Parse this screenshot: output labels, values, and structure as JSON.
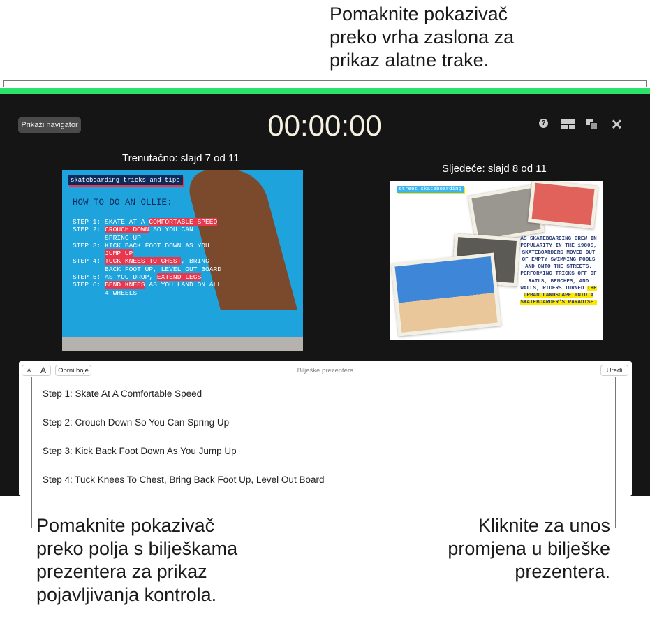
{
  "callouts": {
    "top": [
      "Pomaknite pokazivač",
      "preko vrha zaslona za",
      "prikaz alatne trake."
    ],
    "bottom_left": [
      "Pomaknite pokazivač",
      "preko polja s bilješkama",
      "prezentera za prikaz",
      "pojavljivanja kontrola."
    ],
    "bottom_right": [
      "Kliknite za unos",
      "promjena u bilješke",
      "prezentera."
    ]
  },
  "toolbar": {
    "navigator_label": "Prikaži navigator",
    "timer": "00:00:00",
    "icons": [
      "help-icon",
      "layout-icon",
      "switch-display-icon",
      "close-icon"
    ]
  },
  "current": {
    "label": "Trenutačno: slajd 7 od 11",
    "tag": "skateboarding tricks and tips",
    "heading": "HOW TO DO AN OLLIE:",
    "steps": [
      [
        "STEP 1: SKATE AT A ",
        "COMFORTABLE SPEED",
        ""
      ],
      [
        "STEP 2: ",
        "CROUCH DOWN",
        " SO YOU CAN\n        SPRING UP"
      ],
      [
        "STEP 3: KICK BACK FOOT DOWN AS YOU\n        ",
        "JUMP UP",
        ""
      ],
      [
        "STEP 4: ",
        "TUCK KNEES TO CHEST",
        ", BRING\n        BACK FOOT UP, LEVEL OUT BOARD"
      ],
      [
        "STEP 5: AS YOU DROP, ",
        "EXTEND LEGS",
        ""
      ],
      [
        "STEP 6: ",
        "BEND KNEES",
        " AS YOU LAND ON ALL\n        4 WHEELS"
      ]
    ]
  },
  "next": {
    "label": "Sljedeće: slajd 8 od 11",
    "tag": "street skateboarding",
    "text": "AS SKATEBOARDING GREW IN POPULARITY IN THE 1980S, SKATEBOARDERS MOVED OUT OF EMPTY SWIMMING POOLS AND ONTO THE STREETS. PERFORMING TRICKS OFF OF RAILS, BENCHES, AND WALLS, RIDERS TURNED ",
    "highlight": "THE URBAN LANDSCAPE INTO A SKATEBOARDER'S PARADISE."
  },
  "notes": {
    "small_a": "A",
    "large_a": "A",
    "invert_label": "Obrni boje",
    "title": "Bilješke prezentera",
    "edit_label": "Uredi",
    "lines": [
      "Step 1: Skate At A Comfortable Speed",
      "Step 2: Crouch Down So You Can Spring Up",
      "Step 3: Kick Back Foot Down As You Jump Up",
      "Step 4: Tuck Knees To Chest, Bring Back Foot Up, Level Out Board"
    ]
  },
  "colors": {
    "accent_green": "#2be36b",
    "highlight_red": "#e8384f",
    "highlight_yellow": "#ffe800"
  }
}
